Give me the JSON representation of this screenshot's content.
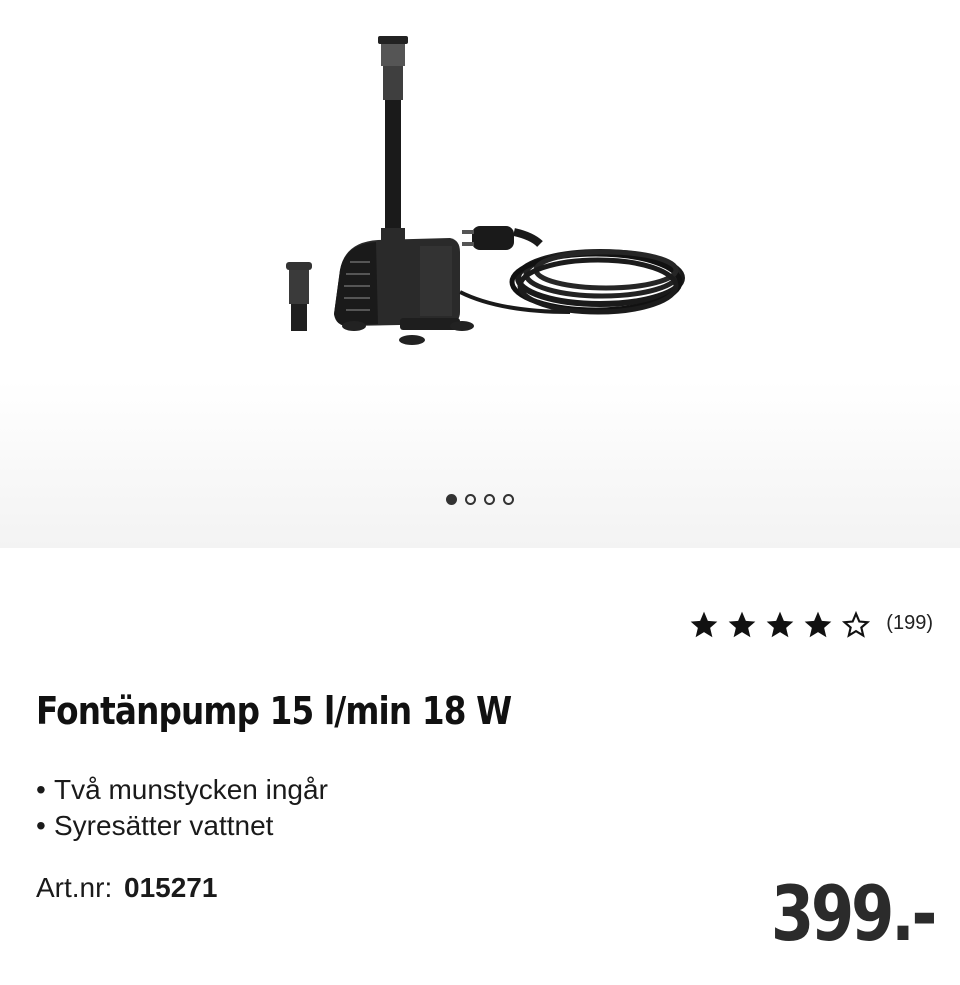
{
  "gallery": {
    "image_name": "fountain-pump-product-image",
    "dot_count": 4,
    "active_index": 0
  },
  "rating": {
    "stars_filled": 4,
    "stars_total": 5,
    "review_count": "(199)"
  },
  "product": {
    "title": "Fontänpump 15 l/min 18 W",
    "features": [
      "Två munstycken ingår",
      "Syresätter vattnet"
    ],
    "art_label": "Art.nr:",
    "art_number": "015271",
    "price": "399.-"
  },
  "colors": {
    "text": "#111111",
    "price": "#2b2b2b",
    "dot": "#333333",
    "gallery_bg_bottom": "#f3f3f3"
  }
}
